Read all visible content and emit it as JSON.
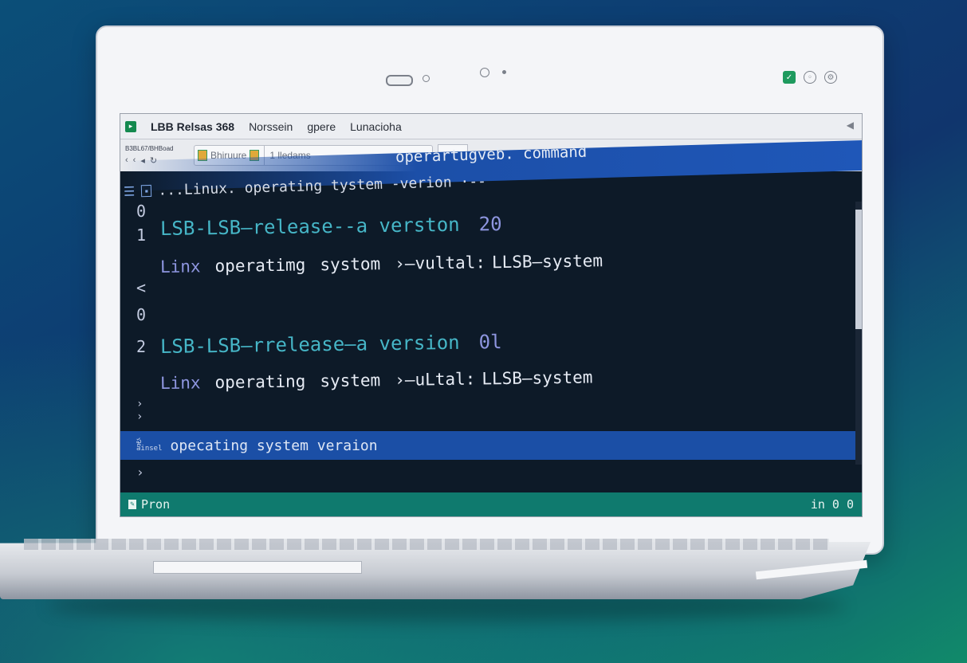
{
  "window": {
    "title": "LBB Relsas 368",
    "menu": [
      "Norssein",
      "gpere",
      "Lunacioha"
    ]
  },
  "toolbar": {
    "small_label": "B3BL67/BHBoad",
    "tab_label": "Bhiruure",
    "address": "1 lledams",
    "go_symbol": "↙ 🔒"
  },
  "header": {
    "command_title": "operartugveb. command",
    "path": "...Linux. operating tystem -verion ·-- "
  },
  "terminal": {
    "gutter": [
      "0",
      "1",
      "<",
      "0",
      "2",
      "›",
      "›",
      "›"
    ],
    "entries": [
      {
        "command": "LSB-LSB—release--a  verston",
        "number": "20",
        "sub_prefix": "Linx",
        "sub_words": [
          "operatimg",
          "systom",
          "›—vultal:",
          "LLSB—system"
        ]
      },
      {
        "command": "LSB-LSB—rrelease—a  version",
        "number": "0l",
        "sub_prefix": "Linx",
        "sub_words": [
          "operating",
          "system",
          "›—uLtal:",
          "LLSB—system"
        ]
      }
    ],
    "highlight_tag": "ఫ్ల",
    "highlight_tag2": "ainsel",
    "highlight_text": "opecating system veraion"
  },
  "status": {
    "left": "Pron",
    "right": "in 0 0"
  },
  "icons": {
    "app": "terminal-icon",
    "menu": "hamburger-icon",
    "tray": [
      "shield-icon",
      "circle-icon",
      "gear-icon"
    ]
  }
}
